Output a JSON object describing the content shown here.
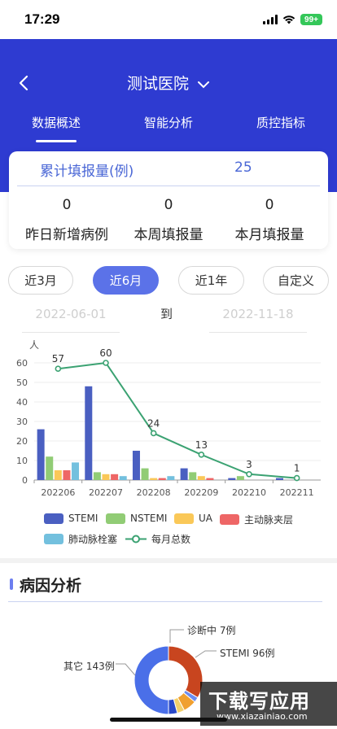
{
  "status_bar": {
    "time": "17:29",
    "battery": "99+"
  },
  "header": {
    "hospital": "测试医院",
    "tabs": [
      {
        "label": "数据概述",
        "active": true
      },
      {
        "label": "智能分析",
        "active": false
      },
      {
        "label": "质控指标",
        "active": false
      }
    ],
    "accent_color": "#2e3bd1"
  },
  "summary": {
    "cumulative_label": "累计填报量(例)",
    "cumulative_value": "25",
    "stats": [
      {
        "value": "0",
        "label": "昨日新增病例"
      },
      {
        "value": "0",
        "label": "本周填报量"
      },
      {
        "value": "0",
        "label": "本月填报量"
      }
    ]
  },
  "period_filter": {
    "options": [
      "近3月",
      "近6月",
      "近1年",
      "自定义"
    ],
    "selected": "近6月"
  },
  "date_range": {
    "start": "2022-06-01",
    "separator": "到",
    "end": "2022-11-18"
  },
  "chart_data": {
    "type": "bar",
    "ylabel": "人",
    "ylim": [
      0,
      60
    ],
    "yticks": [
      0,
      10,
      20,
      30,
      40,
      50,
      60
    ],
    "categories": [
      "202206",
      "202207",
      "202208",
      "202209",
      "202210",
      "202211"
    ],
    "series": [
      {
        "name": "STEMI",
        "color": "#4a5fc1",
        "values": [
          26,
          48,
          15,
          6,
          1,
          1
        ]
      },
      {
        "name": "NSTEMI",
        "color": "#91cc75",
        "values": [
          12,
          4,
          6,
          4,
          2,
          0
        ]
      },
      {
        "name": "UA",
        "color": "#fac858",
        "values": [
          5,
          3,
          1,
          2,
          0,
          0
        ]
      },
      {
        "name": "主动脉夹层",
        "color": "#ee6666",
        "values": [
          5,
          3,
          1,
          1,
          0,
          0
        ]
      },
      {
        "name": "肺动脉栓塞",
        "color": "#73c0de",
        "values": [
          9,
          2,
          2,
          0,
          0,
          0
        ]
      }
    ],
    "line": {
      "name": "每月总数",
      "color": "#3ba272",
      "values": [
        57,
        60,
        24,
        13,
        3,
        1
      ]
    },
    "legend_position": "bottom"
  },
  "cause_section": {
    "title": "病因分析",
    "pie": {
      "type": "pie",
      "slices": [
        {
          "label": "其它 143例",
          "value": 143,
          "color": "#4a6fe8"
        },
        {
          "label": "STEMI 96例",
          "value": 96,
          "color": "#c8451f"
        },
        {
          "label": "诊断中 7例",
          "value": 7,
          "color": "#6b8cf0"
        },
        {
          "label": "",
          "value": 18,
          "color": "#f0a030"
        },
        {
          "label": "",
          "value": 10,
          "color": "#f3d06b"
        },
        {
          "label": "",
          "value": 12,
          "color": "#2a49c9"
        }
      ]
    }
  },
  "watermark": {
    "main": "下载写应用",
    "sub": "www.xiazainiao.com"
  }
}
